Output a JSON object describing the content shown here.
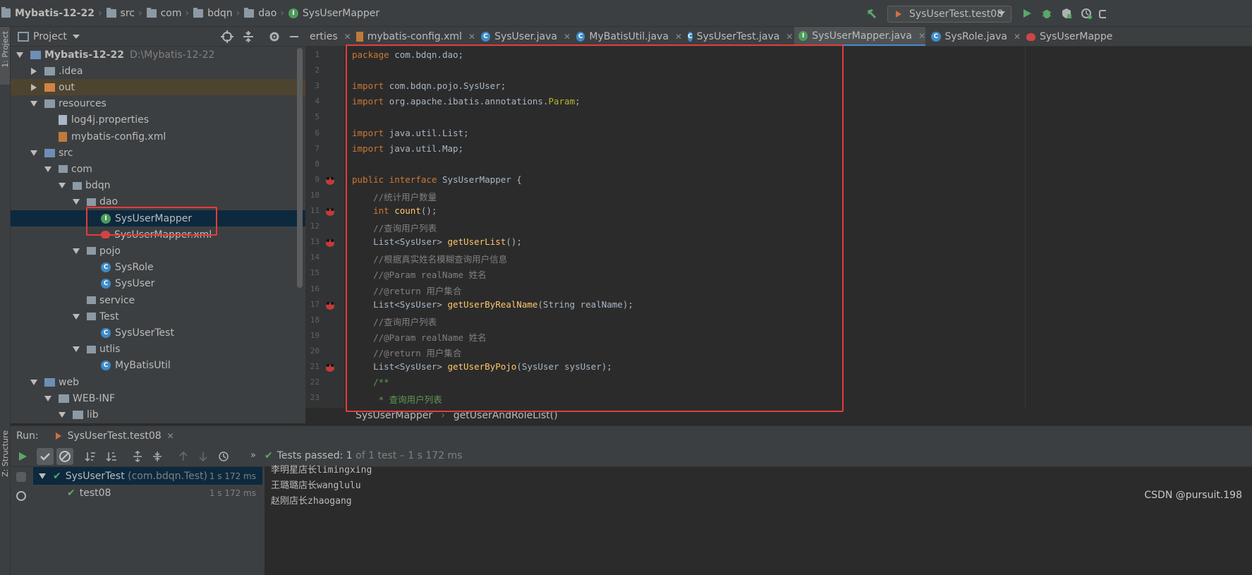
{
  "navbar": {
    "project": "Mybatis-12-22",
    "crumbs": [
      "src",
      "com",
      "bdqn",
      "dao"
    ],
    "file": "SysUserMapper",
    "run_config": "SysUserTest.test08"
  },
  "left_strip": {
    "project_tool": "1: Project",
    "structure_tool": "Z: Structure"
  },
  "project_panel": {
    "title": "Project",
    "tree": [
      {
        "label": "Mybatis-12-22",
        "path": "D:\\Mybatis-12-22",
        "depth": 0,
        "toggle": "down",
        "icon": "module"
      },
      {
        "label": ".idea",
        "depth": 1,
        "toggle": "right",
        "icon": "folder"
      },
      {
        "label": "out",
        "depth": 1,
        "toggle": "right",
        "icon": "folder-orange",
        "highlighted": true
      },
      {
        "label": "resources",
        "depth": 1,
        "toggle": "down",
        "icon": "folder"
      },
      {
        "label": "log4j.properties",
        "depth": 2,
        "toggle": "none",
        "icon": "properties"
      },
      {
        "label": "mybatis-config.xml",
        "depth": 2,
        "toggle": "none",
        "icon": "xml"
      },
      {
        "label": "src",
        "depth": 1,
        "toggle": "down",
        "icon": "folder-blue"
      },
      {
        "label": "com",
        "depth": 2,
        "toggle": "down",
        "icon": "package"
      },
      {
        "label": "bdqn",
        "depth": 3,
        "toggle": "down",
        "icon": "package"
      },
      {
        "label": "dao",
        "depth": 4,
        "toggle": "down",
        "icon": "package"
      },
      {
        "label": "SysUserMapper",
        "depth": 5,
        "toggle": "none",
        "icon": "interface",
        "selected": true
      },
      {
        "label": "SysUserMapper.xml",
        "depth": 5,
        "toggle": "none",
        "icon": "mybatis"
      },
      {
        "label": "pojo",
        "depth": 4,
        "toggle": "down",
        "icon": "package"
      },
      {
        "label": "SysRole",
        "depth": 5,
        "toggle": "none",
        "icon": "class"
      },
      {
        "label": "SysUser",
        "depth": 5,
        "toggle": "none",
        "icon": "class"
      },
      {
        "label": "service",
        "depth": 4,
        "toggle": "none",
        "icon": "package"
      },
      {
        "label": "Test",
        "depth": 4,
        "toggle": "down",
        "icon": "package"
      },
      {
        "label": "SysUserTest",
        "depth": 5,
        "toggle": "none",
        "icon": "test-class"
      },
      {
        "label": "utlis",
        "depth": 4,
        "toggle": "down",
        "icon": "package"
      },
      {
        "label": "MyBatisUtil",
        "depth": 5,
        "toggle": "none",
        "icon": "class"
      },
      {
        "label": "web",
        "depth": 1,
        "toggle": "down",
        "icon": "folder-web"
      },
      {
        "label": "WEB-INF",
        "depth": 2,
        "toggle": "down",
        "icon": "folder"
      },
      {
        "label": "lib",
        "depth": 3,
        "toggle": "down",
        "icon": "folder"
      }
    ]
  },
  "tabs": [
    {
      "label": "erties",
      "icon": "none"
    },
    {
      "label": "mybatis-config.xml",
      "icon": "xml"
    },
    {
      "label": "SysUser.java",
      "icon": "class"
    },
    {
      "label": "MyBatisUtil.java",
      "icon": "class"
    },
    {
      "label": "SysUserTest.java",
      "icon": "class"
    },
    {
      "label": "SysUserMapper.java",
      "icon": "interface",
      "active": true
    },
    {
      "label": "SysRole.java",
      "icon": "class"
    },
    {
      "label": "SysUserMappe",
      "icon": "mybatis"
    }
  ],
  "editor": {
    "lines": [
      {
        "n": "1",
        "parts": [
          [
            "kw",
            "package "
          ],
          [
            "",
            "com.bdqn.dao;"
          ]
        ]
      },
      {
        "n": "2",
        "parts": []
      },
      {
        "n": "3",
        "parts": [
          [
            "kw",
            "import "
          ],
          [
            "",
            "com.bdqn.pojo.SysUser;"
          ]
        ]
      },
      {
        "n": "4",
        "parts": [
          [
            "kw",
            "import "
          ],
          [
            "",
            "org.apache.ibatis.annotations."
          ],
          [
            "ann",
            "Param"
          ],
          [
            "",
            ";"
          ]
        ]
      },
      {
        "n": "5",
        "parts": []
      },
      {
        "n": "6",
        "parts": [
          [
            "kw",
            "import "
          ],
          [
            "",
            "java.util.List;"
          ]
        ]
      },
      {
        "n": "7",
        "parts": [
          [
            "kw",
            "import "
          ],
          [
            "",
            "java.util.Map;"
          ]
        ]
      },
      {
        "n": "8",
        "parts": []
      },
      {
        "n": "9",
        "parts": [
          [
            "kw",
            "public interface "
          ],
          [
            "",
            "SysUserMapper {"
          ]
        ],
        "mark": true
      },
      {
        "n": "10",
        "parts": [
          [
            "cm",
            "    //统计用户数量"
          ]
        ]
      },
      {
        "n": "11",
        "parts": [
          [
            "kw",
            "    int "
          ],
          [
            "fn",
            "count"
          ],
          [
            "",
            "();"
          ]
        ],
        "mark": true
      },
      {
        "n": "12",
        "parts": [
          [
            "cm",
            "    //查询用户列表"
          ]
        ]
      },
      {
        "n": "13",
        "parts": [
          [
            "",
            "    List<SysUser> "
          ],
          [
            "fn",
            "getUserList"
          ],
          [
            "",
            "();"
          ]
        ],
        "mark": true
      },
      {
        "n": "14",
        "parts": [
          [
            "cm",
            "    //根据真实姓名模糊查询用户信息"
          ]
        ]
      },
      {
        "n": "15",
        "parts": [
          [
            "cm",
            "    //@Param realName 姓名"
          ]
        ]
      },
      {
        "n": "16",
        "parts": [
          [
            "cm",
            "    //@return 用户集合"
          ]
        ]
      },
      {
        "n": "17",
        "parts": [
          [
            "",
            "    List<SysUser> "
          ],
          [
            "fn",
            "getUserByRealName"
          ],
          [
            "",
            "(String realName);"
          ]
        ],
        "mark": true
      },
      {
        "n": "18",
        "parts": [
          [
            "cm",
            "    //查询用户列表"
          ]
        ]
      },
      {
        "n": "19",
        "parts": [
          [
            "cm",
            "    //@Param realName 姓名"
          ]
        ]
      },
      {
        "n": "20",
        "parts": [
          [
            "cm",
            "    //@return 用户集合"
          ]
        ]
      },
      {
        "n": "21",
        "parts": [
          [
            "",
            "    List<SysUser> "
          ],
          [
            "fn",
            "getUserByPojo"
          ],
          [
            "",
            "(SysUser sysUser);"
          ]
        ],
        "mark": true
      },
      {
        "n": "22",
        "parts": [
          [
            "doc",
            "    /**"
          ]
        ]
      },
      {
        "n": "23",
        "parts": [
          [
            "doc",
            "     * 查询用户列表"
          ]
        ]
      }
    ],
    "breadcrumb": [
      "SysUserMapper",
      "getUserAndRoleList()"
    ]
  },
  "run_panel": {
    "label": "Run:",
    "tab": "SysUserTest.test08",
    "status_prefix": "Tests passed:",
    "status_count": "1",
    "status_rest": "of 1 test – 1 s 172 ms",
    "tests": [
      {
        "name": "SysUserTest",
        "detail": "(com.bdqn.Test)",
        "time": "1 s 172 ms"
      },
      {
        "name": "test08",
        "detail": "",
        "time": "1 s 172 ms"
      }
    ],
    "console": [
      "李明星店长limingxing",
      "王璐璐店长wanglulu",
      "赵刚店长zhaogang"
    ]
  },
  "watermark": "CSDN @pursuit.198"
}
